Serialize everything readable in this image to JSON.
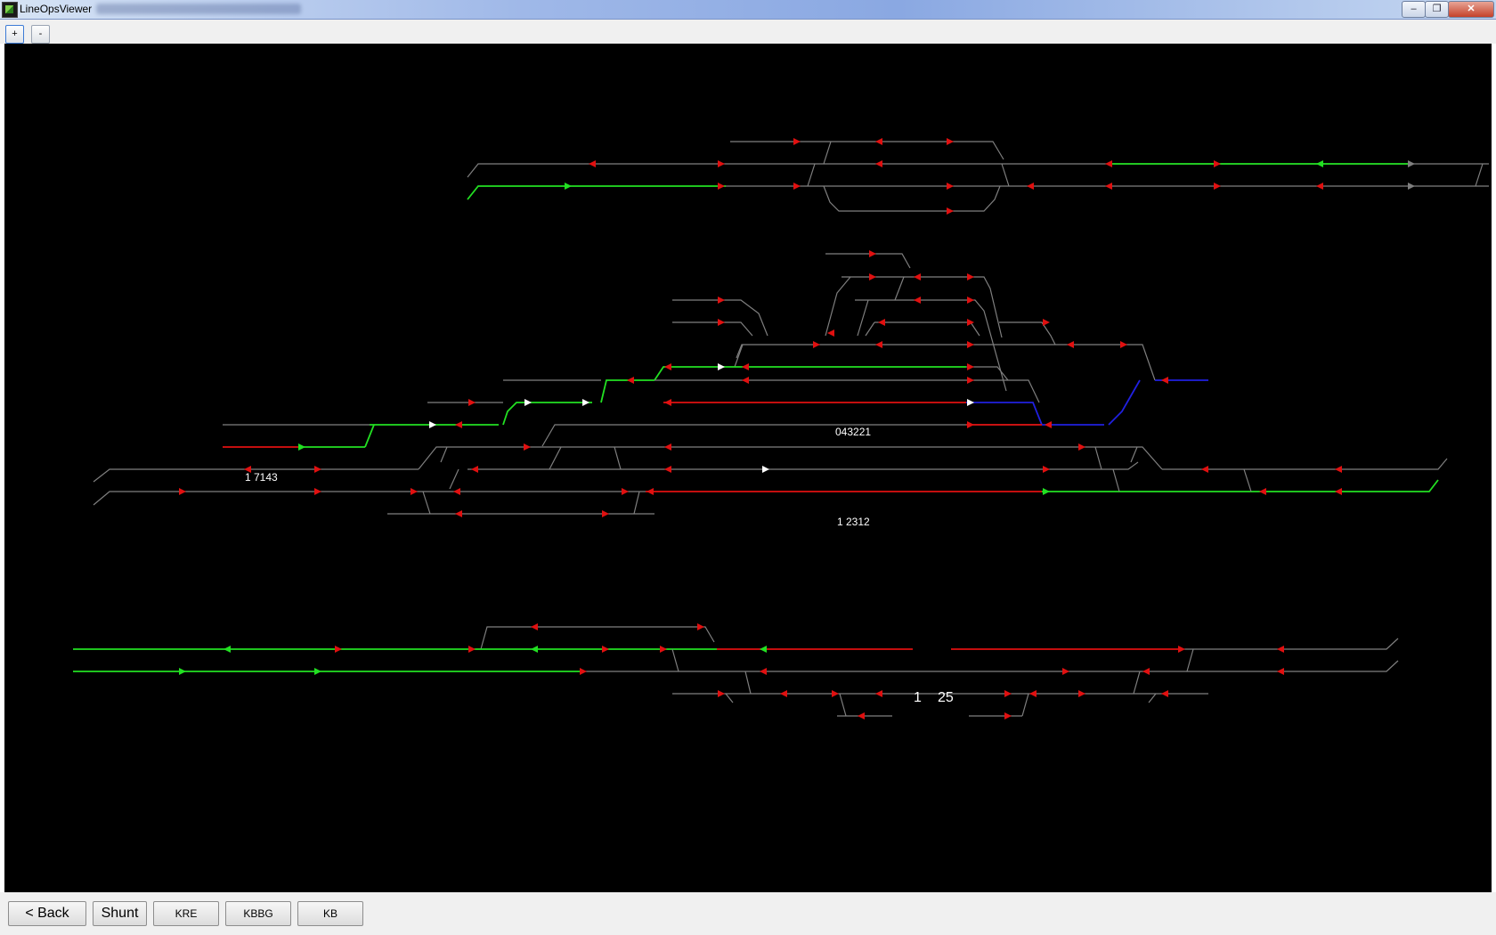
{
  "window": {
    "title": "LineOpsViewer",
    "controls": {
      "minimize": "–",
      "maximize": "❐",
      "close": "✕"
    },
    "icon": "app-logo-icon"
  },
  "toolbar": {
    "zoom_in_label": "+",
    "zoom_out_label": "-"
  },
  "colors": {
    "canvas_background": "#000000",
    "track_idle": "#7f7f7f",
    "route_set": "#22e022",
    "occupied": "#e01010",
    "reserved": "#2020e0",
    "signal_stop": "#e01010",
    "signal_proceed": "#22e022",
    "signal_neutral": "#ffffff"
  },
  "train_labels": [
    {
      "id": "train-label-043221",
      "text": "043221"
    },
    {
      "id": "train-label-17143",
      "text": "1 7143"
    },
    {
      "id": "train-label-12312",
      "text": "1 2312"
    },
    {
      "id": "train-label-1",
      "text": "1"
    },
    {
      "id": "train-label-25",
      "text": "25"
    }
  ],
  "bottom_buttons": {
    "back": "< Back",
    "shunt": "Shunt",
    "kre": "KRE",
    "kbbg": "KBBG",
    "kb": "KB"
  }
}
